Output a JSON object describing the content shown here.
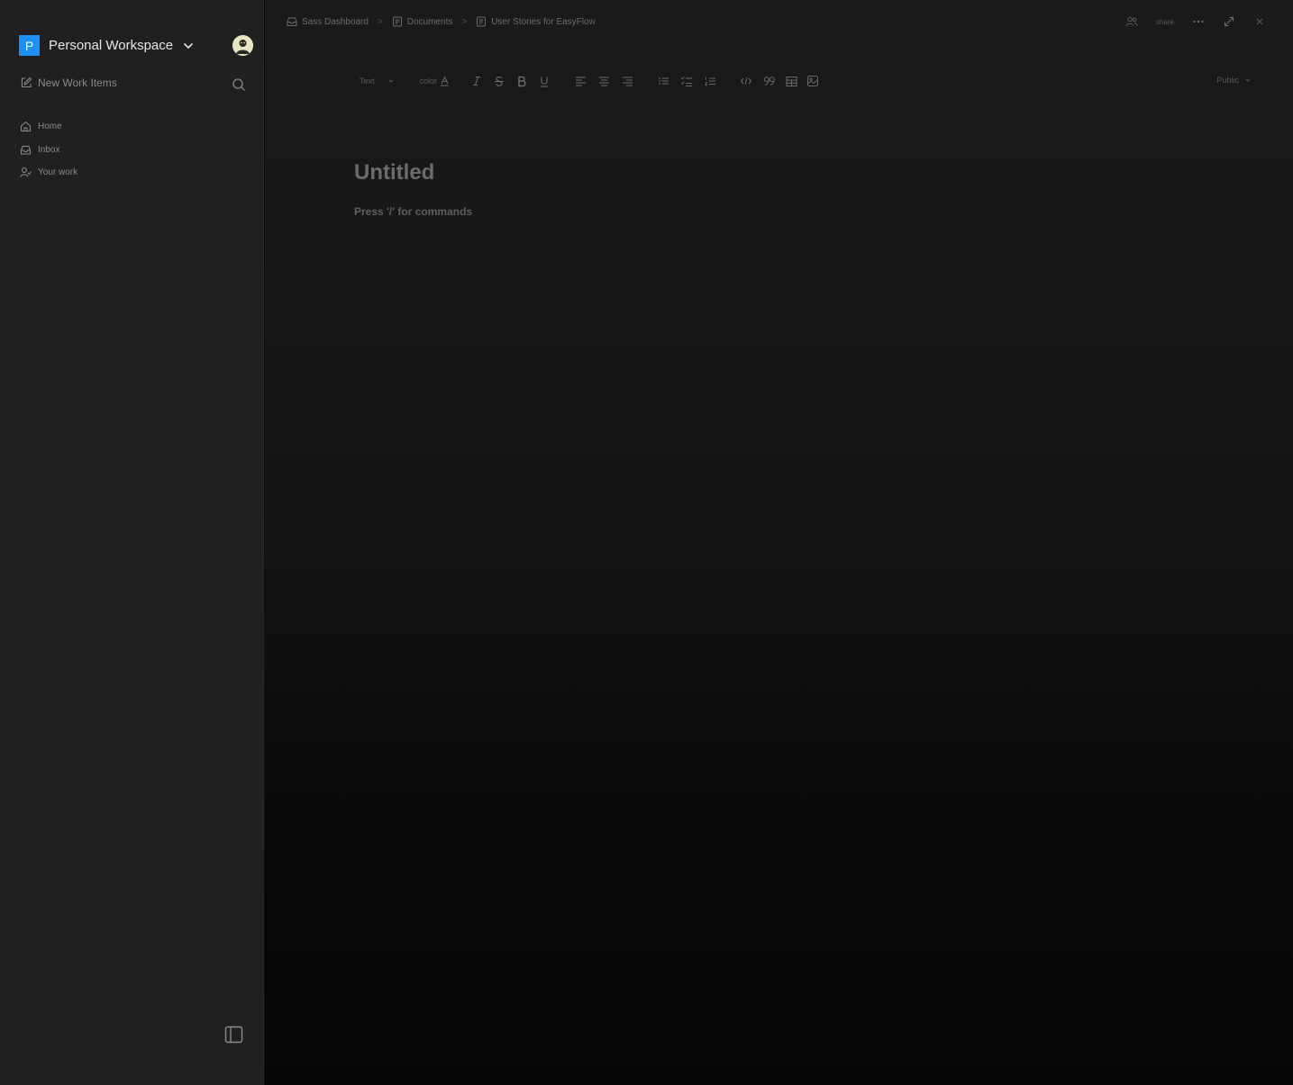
{
  "sidebar": {
    "workspace": {
      "initial": "P",
      "name": "Personal Workspace",
      "badge_color": "#1e90f5"
    },
    "new_work_label": "New Work Items",
    "nav": [
      {
        "label": "Home",
        "icon": "home-icon"
      },
      {
        "label": "Inbox",
        "icon": "inbox-icon"
      },
      {
        "label": "Your work",
        "icon": "user-work-icon"
      }
    ]
  },
  "breadcrumb": [
    {
      "label": "Sass Dashboard",
      "icon": "project-icon"
    },
    {
      "label": "Documents",
      "icon": "document-icon"
    },
    {
      "label": "User Stories for EasyFlow",
      "icon": "document-icon"
    }
  ],
  "breadcrumb_separator": ">",
  "top_actions": {
    "share_label": "share"
  },
  "toolbar": {
    "text_style": "Text",
    "color_label": "color",
    "visibility": "Public"
  },
  "editor": {
    "title_placeholder": "Untitled",
    "body_placeholder": "Press '/' for commands"
  }
}
